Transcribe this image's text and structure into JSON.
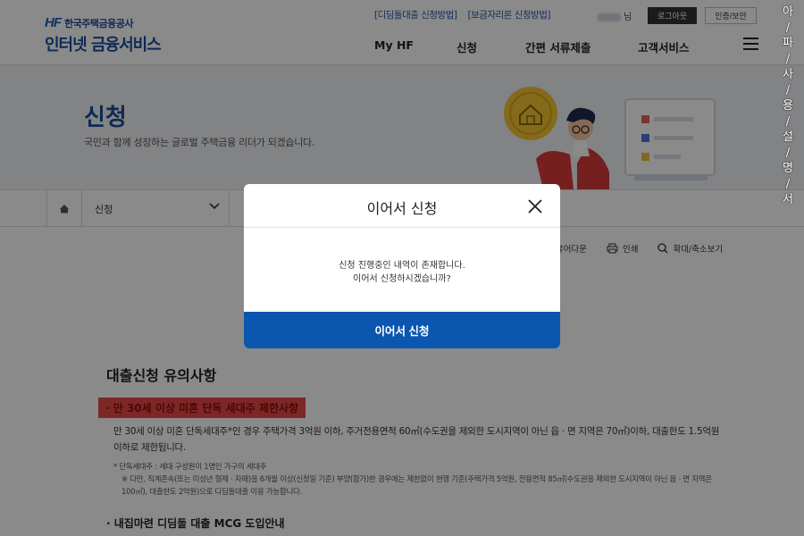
{
  "header": {
    "logo_hf": "HF",
    "logo_org": "한국주택금융공사",
    "logo_service": "인터넷 금융서비스",
    "top_links": [
      "[디딤돌대출 신청방법]",
      "[보금자리론 신청방법]"
    ],
    "user_suffix": "님",
    "logout_label": "로그아웃",
    "cert_label": "인증/보안",
    "nav": [
      "My HF",
      "신청",
      "간편 서류제출",
      "고객서비스"
    ]
  },
  "banner": {
    "title": "신청",
    "subtitle": "국민과 함께 성장하는 글로벌 주택금융 리더가 되겠습니다."
  },
  "breadcrumb": {
    "selected": "신청"
  },
  "tools": {
    "viewer": "뷰어다운",
    "print": "인쇄",
    "zoom": "확대/축소보기"
  },
  "content": {
    "section_title": "대출신청 유의사항",
    "highlight": "· 만 30세 이상 미혼 단독 세대주 제한사항",
    "paragraph": "만 30세 이상 미혼 단독세대주*인 경우 주택가격 3억원 이하, 주거전용면적 60㎡(수도권을 제외한 도시지역이 아닌 읍 · 면 지역은 70㎡)이하, 대출한도 1.5억원 이하로 제한됩니다.",
    "note_1": "* 단독세대주 : 세대 구성원이 1명인 가구의 세대주",
    "note_2": "※ 다만, 직계존속(또는 미성년 형제 · 자매)을 6개월 이상(신청일 기준) 부양(합가)한 경우에는 제한없이 현행 기준(주택가격 5억원, 전용면적 85㎡(수도권을 제외한 도시지역이 아닌 읍 · 면 지역은 100㎡), 대출한도 2억원)으로 디딤돌대출 이용 가능합니다.",
    "section2_title": "· 내집마련 디딤돌 대출 MCG 도입안내"
  },
  "modal": {
    "title": "이어서 신청",
    "message_line1": "신청 진행중인 내역이 존재합니다.",
    "message_line2": "이어서 신청하시겠습니까?",
    "confirm_label": "이어서 신청"
  },
  "watermark": [
    "아",
    "/",
    "파",
    "/",
    "사",
    "/",
    "용",
    "/",
    "설",
    "/",
    "명",
    "/",
    "서"
  ],
  "colors": {
    "brand": "#1a4f9c",
    "modal_button": "#0b57b0",
    "highlight": "#e84848"
  }
}
